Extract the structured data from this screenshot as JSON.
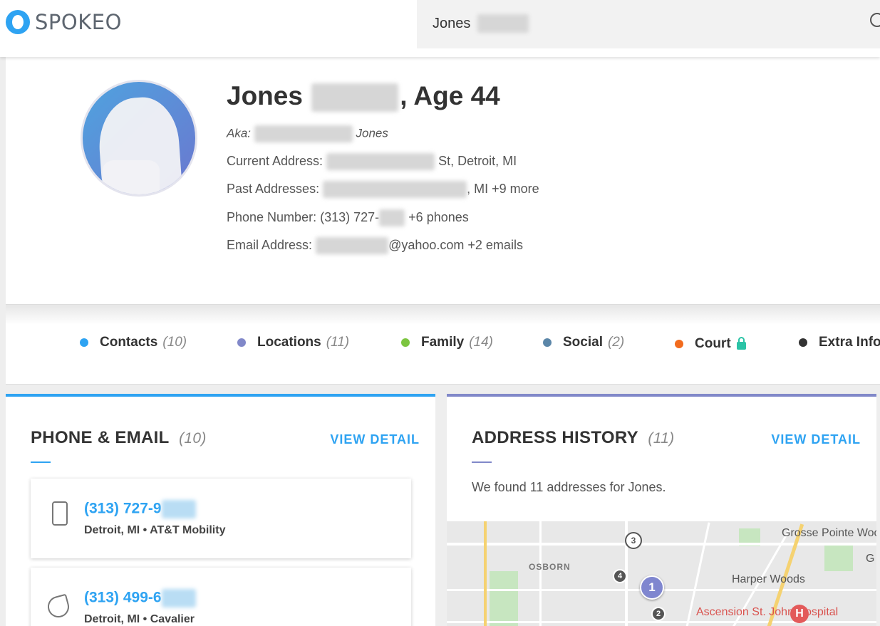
{
  "header": {
    "logo_text": "SPOKEO",
    "search_value": "Jones"
  },
  "profile": {
    "name_first": "Jones",
    "name_suffix": ", Age 44",
    "aka_label": "Aka:",
    "aka_suffix": "Jones",
    "current_address_label": "Current Address:",
    "current_address_suffix": "St, Detroit, MI",
    "past_addresses_label": "Past Addresses:",
    "past_addresses_suffix": ", MI +9 more",
    "phone_label": "Phone Number:",
    "phone_prefix": "(313) 727-",
    "phone_suffix": "+6 phones",
    "email_label": "Email Address:",
    "email_suffix": "@yahoo.com +2 emails"
  },
  "tabs": [
    {
      "label": "Contacts",
      "count": "(10)",
      "color": "#2ea3f2"
    },
    {
      "label": "Locations",
      "count": "(11)",
      "color": "#8188c9"
    },
    {
      "label": "Family",
      "count": "(14)",
      "color": "#7cc540"
    },
    {
      "label": "Social",
      "count": "(2)",
      "color": "#5b86a8"
    },
    {
      "label": "Court",
      "count": "",
      "color": "#f26b1d"
    },
    {
      "label": "Extra Info",
      "count": "",
      "color": "#333333"
    }
  ],
  "phone_email": {
    "title": "PHONE & EMAIL",
    "count": "(10)",
    "view_detail": "VIEW DETAIL",
    "items": [
      {
        "number": "(313) 727-9",
        "detail": "Detroit, MI • AT&T Mobility"
      },
      {
        "number": "(313) 499-6",
        "detail": "Detroit, MI • Cavalier"
      }
    ]
  },
  "address_history": {
    "title": "ADDRESS HISTORY",
    "count": "(11)",
    "view_detail": "VIEW DETAIL",
    "found_text": "We found 11 addresses for Jones."
  },
  "map": {
    "labels": {
      "grosse_pointe": "Grosse Pointe Woods",
      "osborn": "OSBORN",
      "harper": "Harper Woods",
      "hospital": "Ascension St. John Hospital",
      "g": "G"
    },
    "pins": {
      "p1": "1",
      "p2": "2",
      "p3": "3",
      "p4": "4",
      "h": "H"
    }
  }
}
